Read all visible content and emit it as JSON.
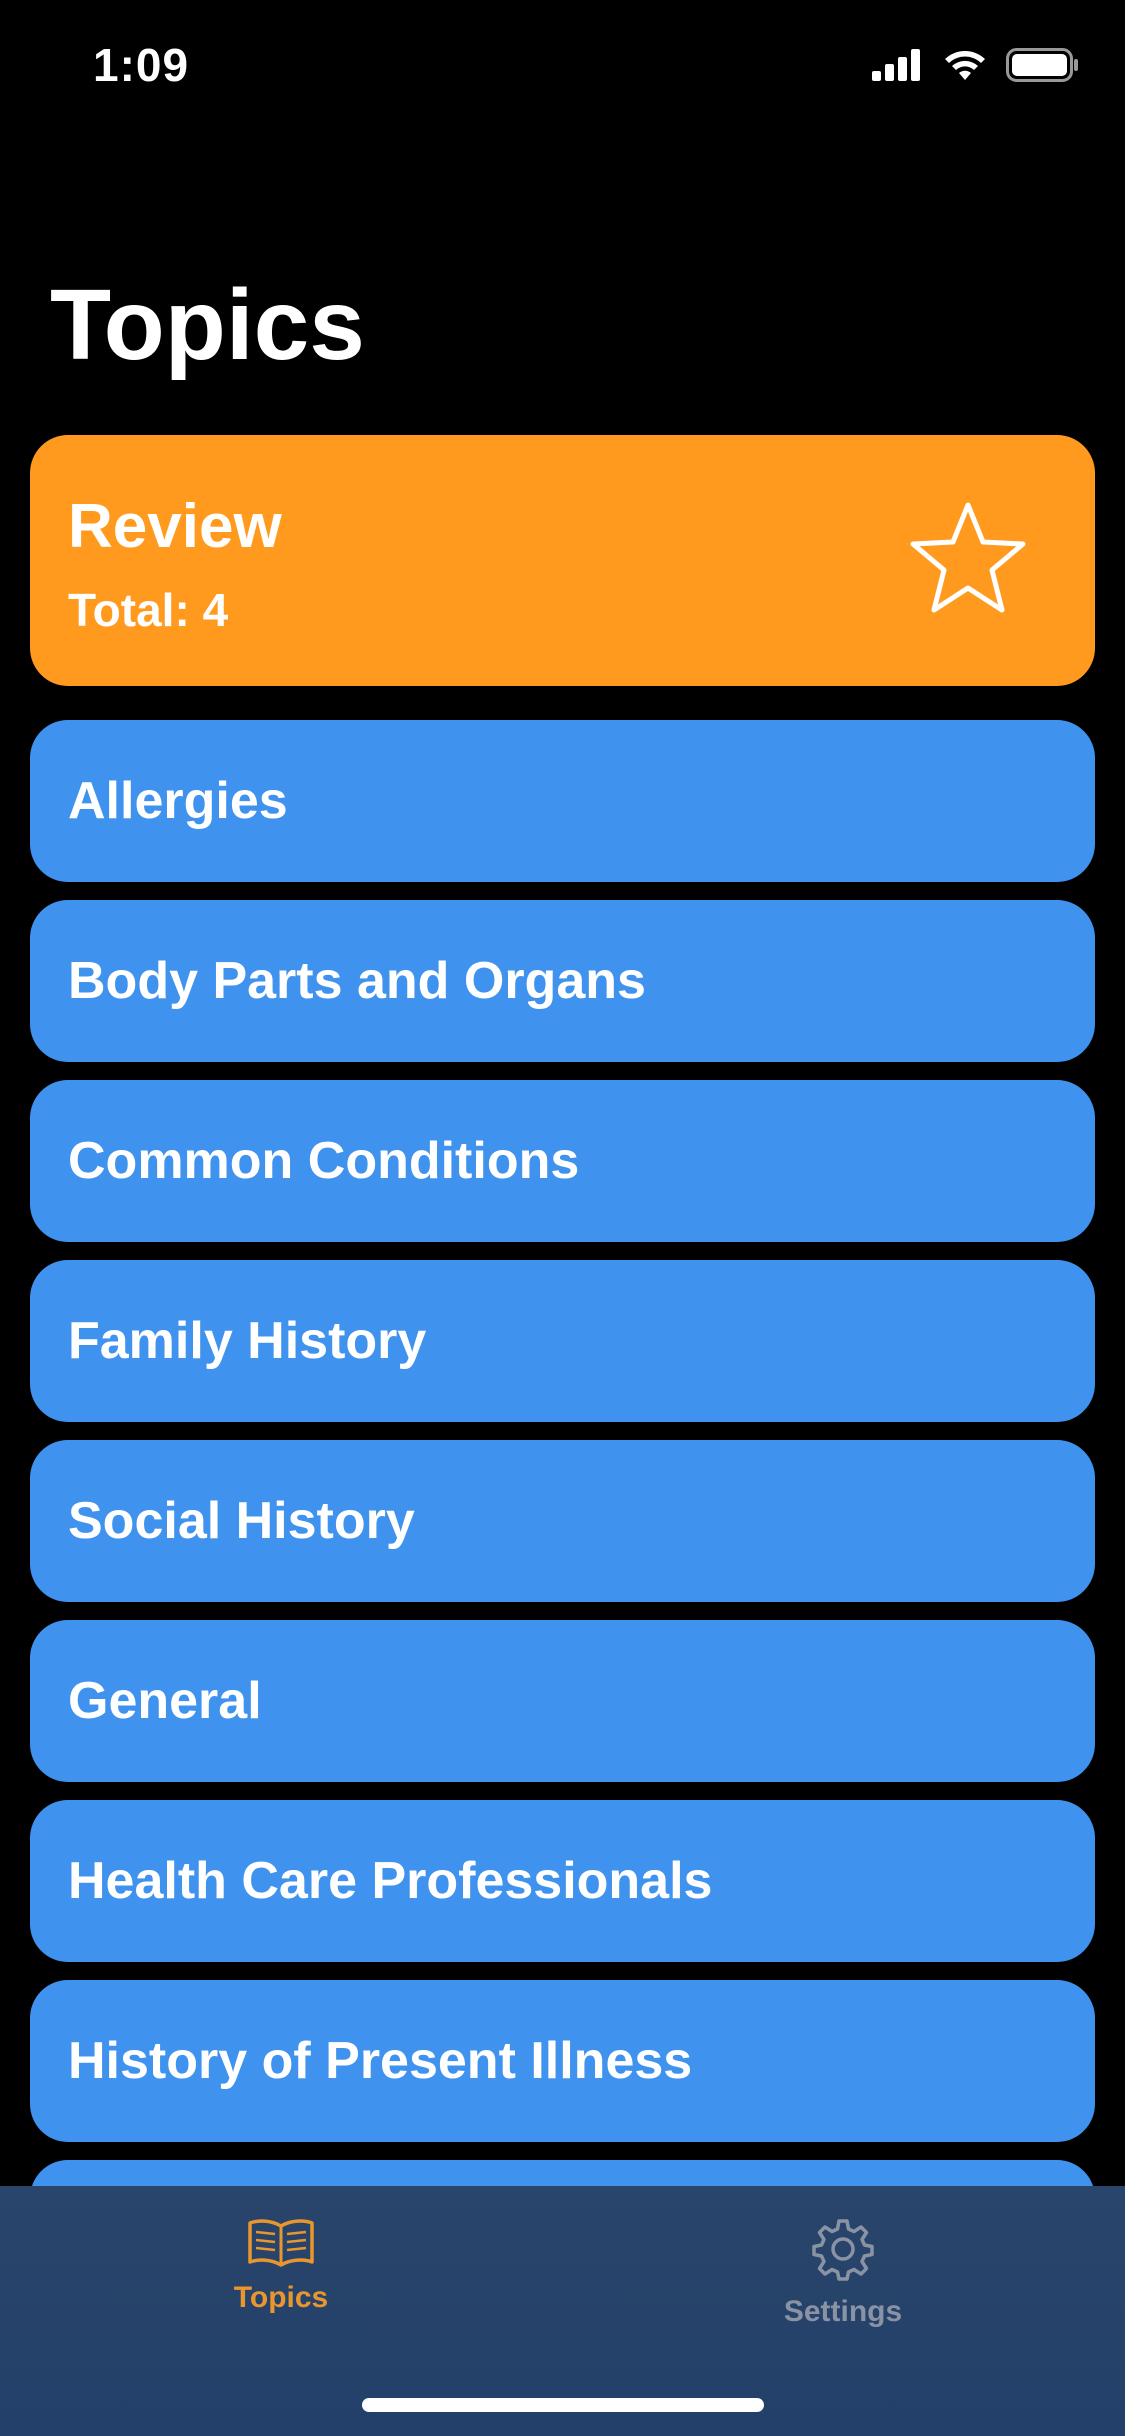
{
  "status_bar": {
    "time": "1:09"
  },
  "page": {
    "title": "Topics"
  },
  "review": {
    "title": "Review",
    "total": "Total: 4",
    "icon": "star-icon",
    "color": "#FF9A1F"
  },
  "topics": [
    {
      "label": "Allergies"
    },
    {
      "label": "Body Parts and Organs"
    },
    {
      "label": "Common Conditions"
    },
    {
      "label": "Family History"
    },
    {
      "label": "Social History"
    },
    {
      "label": "General"
    },
    {
      "label": "Health Care Professionals"
    },
    {
      "label": "History of Present Illness"
    }
  ],
  "topic_color": "#3F93EE",
  "tab_bar": {
    "tabs": [
      {
        "label": "Topics",
        "icon": "book-icon",
        "active": true,
        "color": "#E8962E"
      },
      {
        "label": "Settings",
        "icon": "gear-icon",
        "active": false,
        "color": "#8A93A3"
      }
    ]
  }
}
